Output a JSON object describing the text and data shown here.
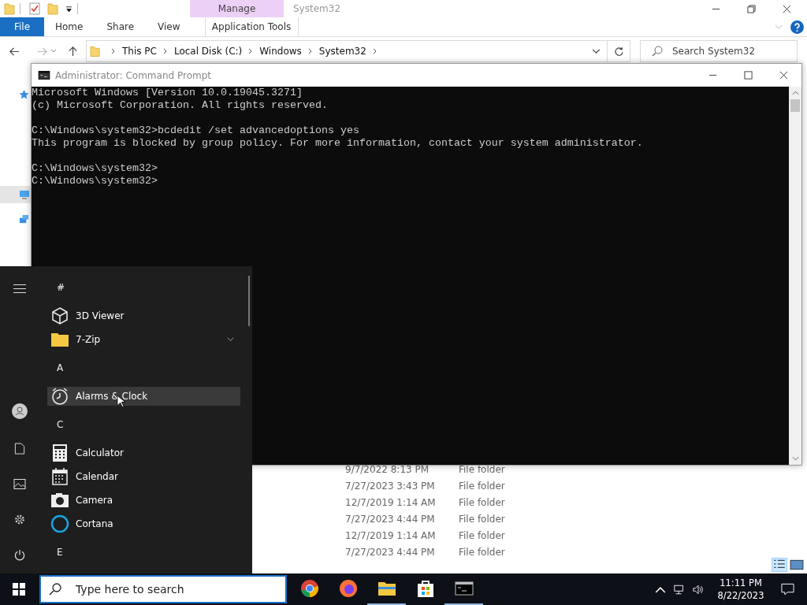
{
  "explorer": {
    "context_group": "Manage",
    "title": "System32",
    "tabs": [
      {
        "label": "File",
        "kind": "file",
        "selected": false
      },
      {
        "label": "Home",
        "kind": "plain",
        "selected": false
      },
      {
        "label": "Share",
        "kind": "plain",
        "selected": false
      },
      {
        "label": "View",
        "kind": "plain",
        "selected": false
      },
      {
        "label": "Application Tools",
        "kind": "context",
        "selected": false
      }
    ],
    "address": [
      "This PC",
      "Local Disk (C:)",
      "Windows",
      "System32"
    ],
    "search": {
      "placeholder": "Search System32"
    },
    "file_rows": [
      {
        "date": "9/7/2022 8:13 PM",
        "type": "File folder"
      },
      {
        "date": "7/27/2023 3:43 PM",
        "type": "File folder"
      },
      {
        "date": "12/7/2019 1:14 AM",
        "type": "File folder"
      },
      {
        "date": "7/27/2023 4:44 PM",
        "type": "File folder"
      },
      {
        "date": "12/7/2019 1:14 AM",
        "type": "File folder"
      },
      {
        "date": "7/27/2023 4:44 PM",
        "type": "File folder"
      }
    ]
  },
  "command_prompt": {
    "title": "Administrator:  Command Prompt",
    "blocks": [
      [
        "Microsoft Windows [Version 10.0.19045.3271]",
        "(c) Microsoft Corporation. All rights reserved."
      ],
      [
        "C:\\Windows\\system32>bcdedit /set advancedoptions yes",
        "This program is blocked by group policy. For more information, contact your system administrator."
      ],
      [
        "C:\\Windows\\system32>",
        "C:\\Windows\\system32>"
      ]
    ]
  },
  "start_menu": {
    "groups": [
      {
        "letter": "#",
        "apps": [
          {
            "name": "3D Viewer",
            "hovered": false,
            "expandable": false
          },
          {
            "name": "7-Zip",
            "hovered": false,
            "expandable": true
          }
        ]
      },
      {
        "letter": "A",
        "apps": [
          {
            "name": "Alarms & Clock",
            "hovered": true,
            "expandable": false
          }
        ]
      },
      {
        "letter": "C",
        "apps": [
          {
            "name": "Calculator",
            "hovered": false,
            "expandable": false
          },
          {
            "name": "Calendar",
            "hovered": false,
            "expandable": false
          },
          {
            "name": "Camera",
            "hovered": false,
            "expandable": false
          },
          {
            "name": "Cortana",
            "hovered": false,
            "expandable": false
          }
        ]
      },
      {
        "letter": "E"
      }
    ]
  },
  "taskbar": {
    "search": {
      "placeholder": "Type here to search"
    },
    "apps": [
      {
        "running": false
      },
      {
        "running": false
      },
      {
        "running": true
      },
      {
        "running": false
      },
      {
        "running": true
      }
    ],
    "clock": {
      "time": "11:11 PM",
      "date": "8/22/2023"
    }
  }
}
